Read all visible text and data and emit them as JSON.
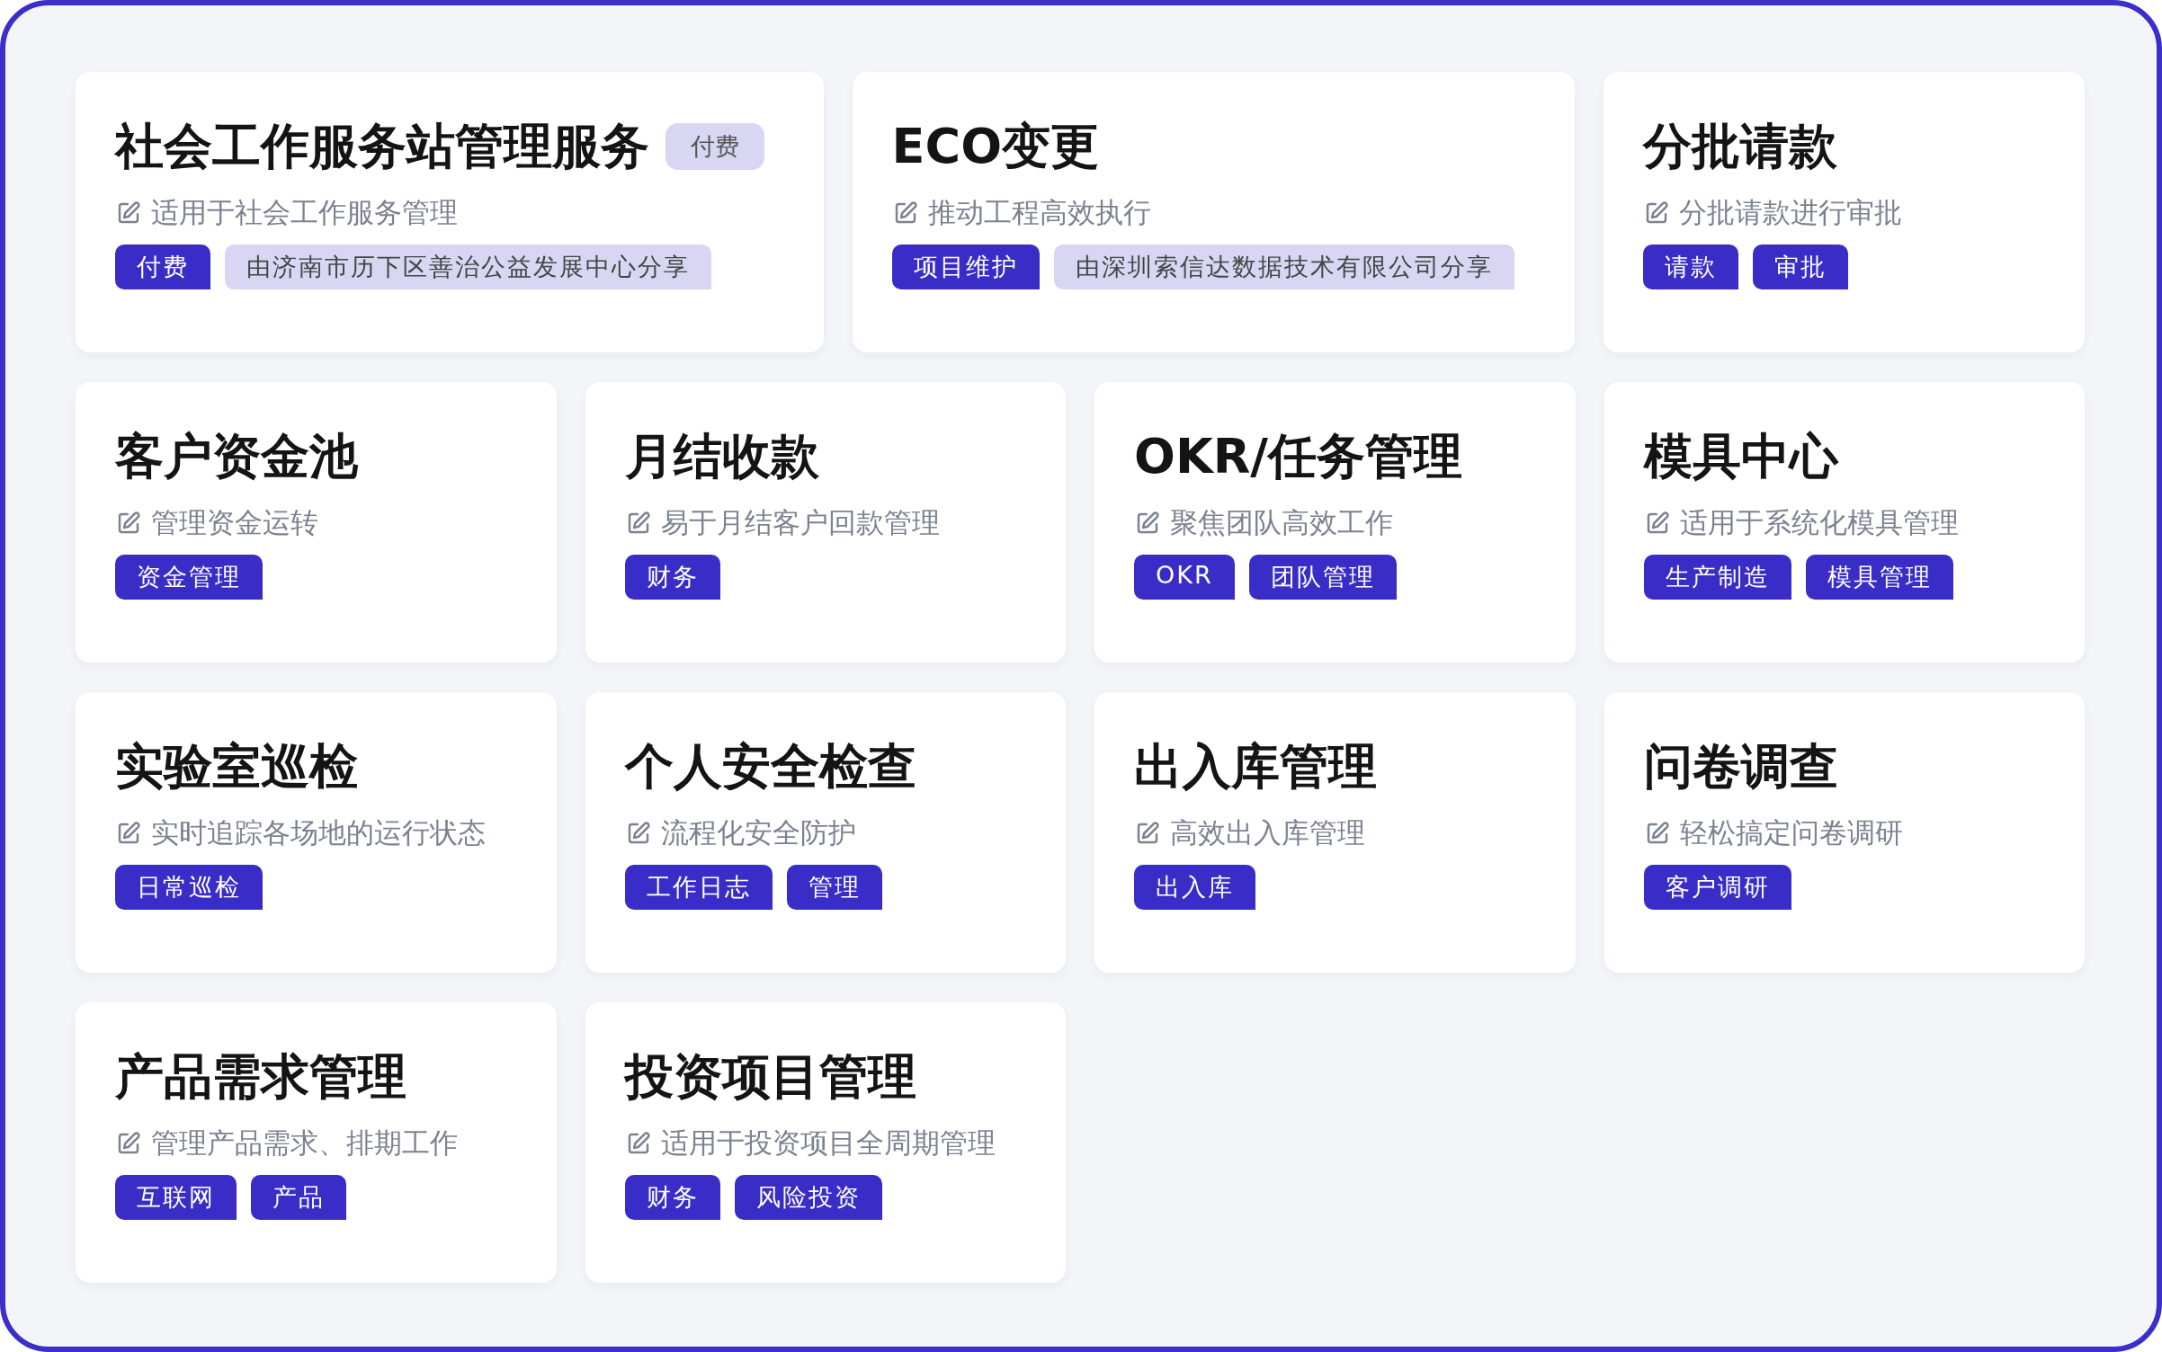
{
  "top_row": [
    {
      "title": "社会工作服务站管理服务",
      "badge": "付费",
      "description": "适用于社会工作服务管理",
      "tags": [
        {
          "label": "付费",
          "kind": "tag"
        },
        {
          "label": "由济南市历下区善治公益发展中心分享",
          "kind": "share"
        }
      ]
    },
    {
      "title": "ECO变更",
      "description": "推动工程高效执行",
      "tags": [
        {
          "label": "项目维护",
          "kind": "tag"
        },
        {
          "label": "由深圳索信达数据技术有限公司分享",
          "kind": "share"
        }
      ]
    },
    {
      "title": "分批请款",
      "description": "分批请款进行审批",
      "tags": [
        {
          "label": "请款",
          "kind": "tag"
        },
        {
          "label": "审批",
          "kind": "tag"
        }
      ]
    }
  ],
  "cards": [
    {
      "title": "客户资金池",
      "description": "管理资金运转",
      "tags": [
        {
          "label": "资金管理",
          "kind": "tag"
        }
      ]
    },
    {
      "title": "月结收款",
      "description": "易于月结客户回款管理",
      "tags": [
        {
          "label": "财务",
          "kind": "tag"
        }
      ]
    },
    {
      "title": "OKR/任务管理",
      "description": "聚焦团队高效工作",
      "tags": [
        {
          "label": "OKR",
          "kind": "tag"
        },
        {
          "label": "团队管理",
          "kind": "tag"
        }
      ]
    },
    {
      "title": "模具中心",
      "description": "适用于系统化模具管理",
      "tags": [
        {
          "label": "生产制造",
          "kind": "tag"
        },
        {
          "label": "模具管理",
          "kind": "tag"
        }
      ]
    },
    {
      "title": "实验室巡检",
      "description": "实时追踪各场地的运行状态",
      "tags": [
        {
          "label": "日常巡检",
          "kind": "tag"
        }
      ]
    },
    {
      "title": "个人安全检查",
      "description": "流程化安全防护",
      "tags": [
        {
          "label": "工作日志",
          "kind": "tag"
        },
        {
          "label": "管理",
          "kind": "tag"
        }
      ]
    },
    {
      "title": "出入库管理",
      "description": "高效出入库管理",
      "tags": [
        {
          "label": "出入库",
          "kind": "tag"
        }
      ]
    },
    {
      "title": "问卷调查",
      "description": "轻松搞定问卷调研",
      "tags": [
        {
          "label": "客户调研",
          "kind": "tag"
        }
      ]
    },
    {
      "title": "产品需求管理",
      "description": "管理产品需求、排期工作",
      "tags": [
        {
          "label": "互联网",
          "kind": "tag"
        },
        {
          "label": "产品",
          "kind": "tag"
        }
      ]
    },
    {
      "title": "投资项目管理",
      "description": "适用于投资项目全周期管理",
      "tags": [
        {
          "label": "财务",
          "kind": "tag"
        },
        {
          "label": "风险投资",
          "kind": "tag"
        }
      ]
    }
  ]
}
